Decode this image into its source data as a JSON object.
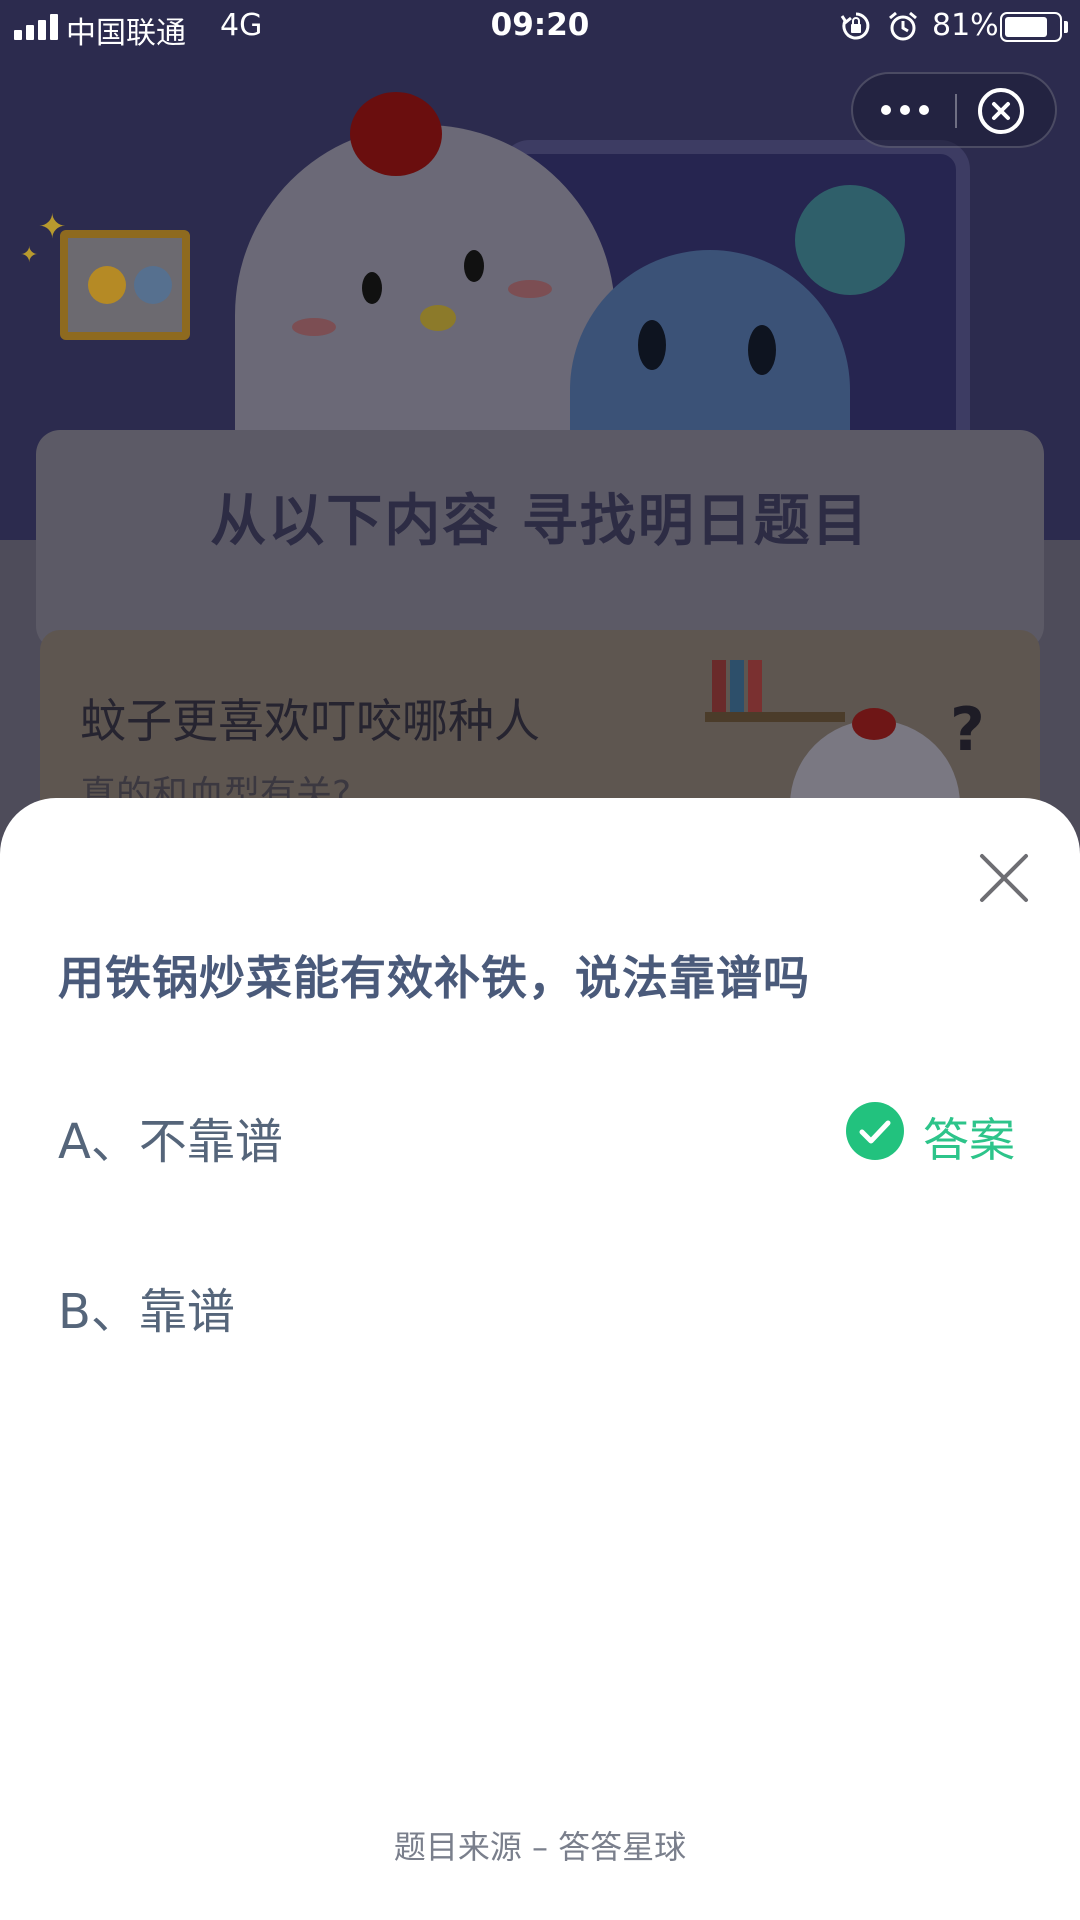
{
  "status_bar": {
    "carrier": "中国联通",
    "network": "4G",
    "time": "09:20",
    "battery_percent": "81%",
    "battery_level": 0.81,
    "icons": [
      "signal-icon",
      "rotation-lock-icon",
      "alarm-icon",
      "battery-icon"
    ]
  },
  "capsule": {
    "icons": [
      "more-icon",
      "close-circle-icon"
    ]
  },
  "background": {
    "banner_title": "从以下内容  寻找明日题目",
    "article_title": "蚊子更喜欢叮咬哪种人",
    "article_subtitle": "真的和血型有关?"
  },
  "sheet": {
    "question": "用铁锅炒菜能有效补铁，说法靠谱吗",
    "options": [
      {
        "label": "A、不靠谱",
        "is_answer": true
      },
      {
        "label": "B、靠谱",
        "is_answer": false
      }
    ],
    "answer_label": "答案",
    "source": "题目来源 – 答答星球"
  },
  "colors": {
    "question_text": "#4a5a7a",
    "option_text": "#55657a",
    "answer_green": "#22c27e",
    "sheet_bg": "#ffffff"
  }
}
